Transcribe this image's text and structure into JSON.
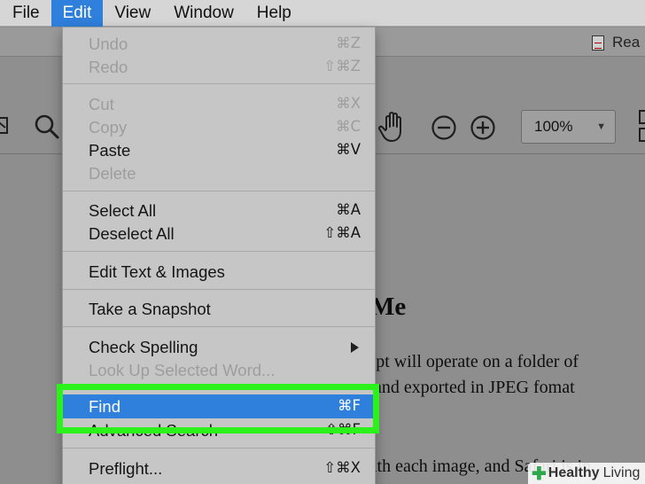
{
  "menubar": {
    "items": [
      {
        "label": ""
      },
      {
        "label": "File"
      },
      {
        "label": "Edit"
      },
      {
        "label": "View"
      },
      {
        "label": "Window"
      },
      {
        "label": "Help"
      }
    ]
  },
  "document_tab": {
    "label": "Rea"
  },
  "toolbar": {
    "zoom_value": "100%"
  },
  "document": {
    "heading": "Me",
    "lines": [
      "ript will operate on a folder of",
      ", and exported in JPEG fomat",
      "ith each image, and Safari is in"
    ]
  },
  "edit_menu": {
    "undo": {
      "label": "Undo",
      "shortcut": "⌘Z"
    },
    "redo": {
      "label": "Redo",
      "shortcut": "⇧⌘Z"
    },
    "cut": {
      "label": "Cut",
      "shortcut": "⌘X"
    },
    "copy": {
      "label": "Copy",
      "shortcut": "⌘C"
    },
    "paste": {
      "label": "Paste",
      "shortcut": "⌘V"
    },
    "delete": {
      "label": "Delete"
    },
    "select_all": {
      "label": "Select All",
      "shortcut": "⌘A"
    },
    "deselect_all": {
      "label": "Deselect All",
      "shortcut": "⇧⌘A"
    },
    "edit_text_images": {
      "label": "Edit Text & Images"
    },
    "take_snapshot": {
      "label": "Take a Snapshot"
    },
    "check_spelling": {
      "label": "Check Spelling"
    },
    "look_up": {
      "label": "Look Up Selected Word..."
    },
    "find": {
      "label": "Find",
      "shortcut": "⌘F"
    },
    "advanced_search": {
      "label": "Advanced Search",
      "shortcut": "⇧⌘F"
    },
    "preflight": {
      "label": "Preflight...",
      "shortcut": "⇧⌘X"
    }
  },
  "watermark": {
    "brand_bold": "Healthy",
    "brand_rest": "Living"
  },
  "colors": {
    "highlight": "#2f7fdc",
    "annotation_green": "#2bf21a",
    "disabled_text": "#9d9d9d"
  }
}
